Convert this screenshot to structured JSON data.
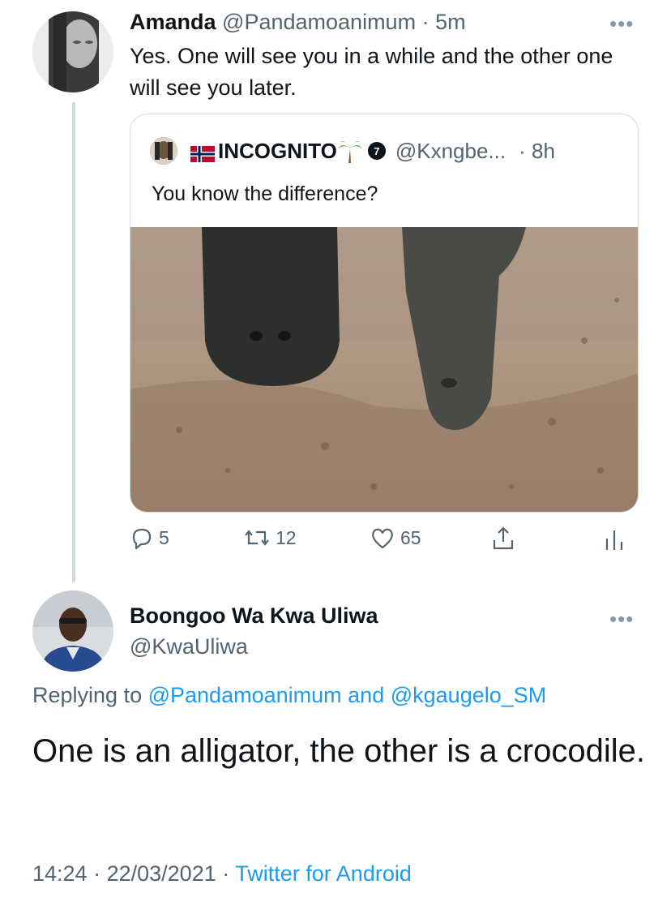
{
  "tweet1": {
    "name": "Amanda",
    "handle": "@Pandamoanimum",
    "time": "· 5m",
    "text": "Yes. One will see you in a while and the other one will see you later.",
    "more": "•••"
  },
  "quote": {
    "flag_name": "INCOGNITO",
    "badge": "7",
    "handle": "@Kxngbe...",
    "time": "· 8h",
    "text": "You know the difference?"
  },
  "actions": {
    "replies": "5",
    "retweets": "12",
    "likes": "65"
  },
  "tweet2": {
    "name": "Boongoo Wa Kwa Uliwa",
    "handle": "@KwaUliwa",
    "more": "•••",
    "replying_prefix": "Replying to",
    "reply_user1": "@Pandamoanimum",
    "reply_and": "and",
    "reply_user2": "@kgaugelo_SM",
    "text": "One is an alligator, the other is a crocodile.",
    "time": "14:24",
    "date": "22/03/2021",
    "source": "Twitter for Android"
  },
  "colors": {
    "link": "#1d9bf0",
    "muted": "#536471",
    "border": "#cfd9de"
  }
}
